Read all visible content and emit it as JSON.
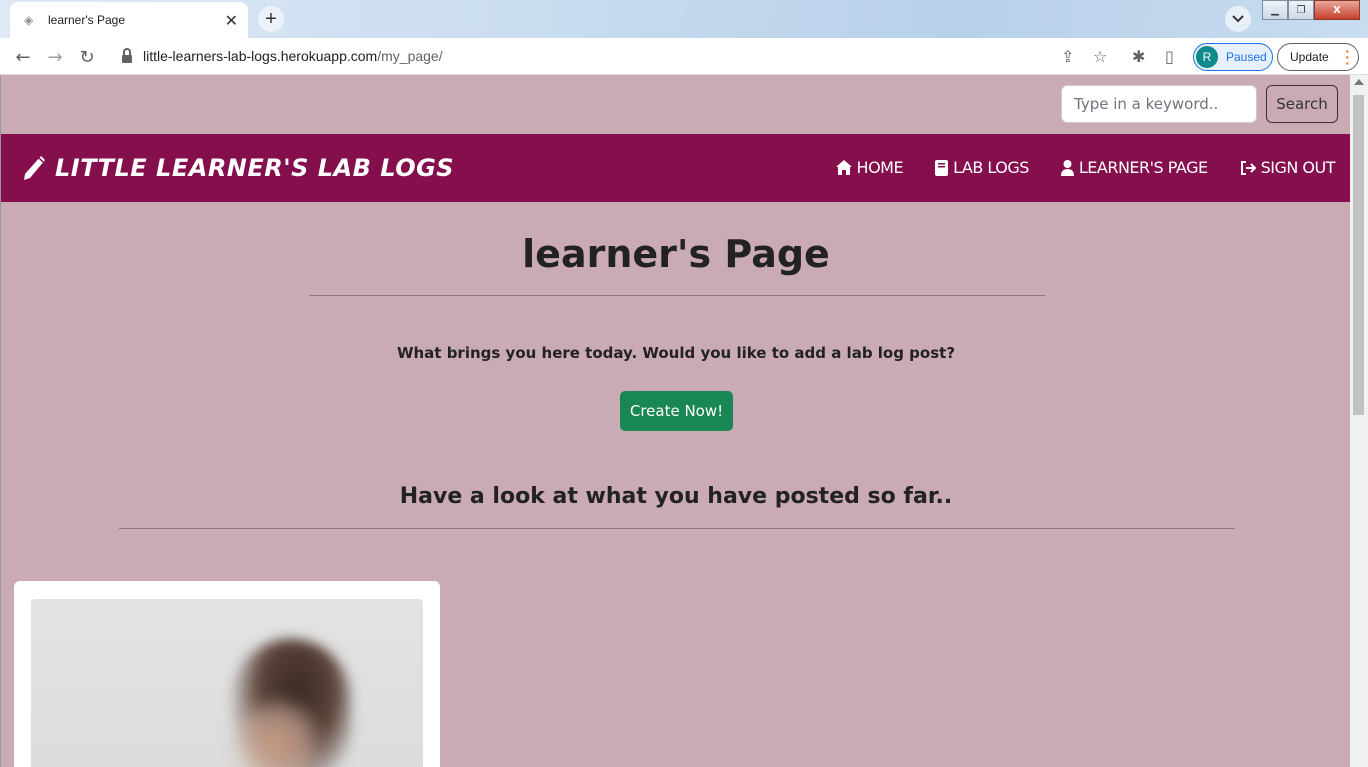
{
  "browser": {
    "tab_title": "learner's Page",
    "tab_close": "✕",
    "new_tab": "+",
    "url_host": "little-learners-lab-logs.herokuapp.com",
    "url_path": "/my_page/",
    "profile_initial": "R",
    "profile_status": "Paused",
    "update_label": "Update"
  },
  "page": {
    "search_placeholder": "Type in a keyword..",
    "search_button": "Search",
    "brand": "LITTLE LEARNER'S LAB LOGS",
    "nav": [
      {
        "label": "HOME",
        "icon": "home-icon"
      },
      {
        "label": "LAB LOGS",
        "icon": "book-icon"
      },
      {
        "label": "LEARNER'S PAGE",
        "icon": "user-icon"
      },
      {
        "label": "SIGN OUT",
        "icon": "sign-out-icon"
      }
    ],
    "title": "learner's Page",
    "prompt": "What brings you here today. Would you like to add a lab log post?",
    "create_button": "Create Now!",
    "subheading": "Have a look at what you have posted so far.."
  },
  "colors": {
    "background": "#caabb5",
    "navbar": "#850f4d",
    "create_button": "#198754"
  }
}
